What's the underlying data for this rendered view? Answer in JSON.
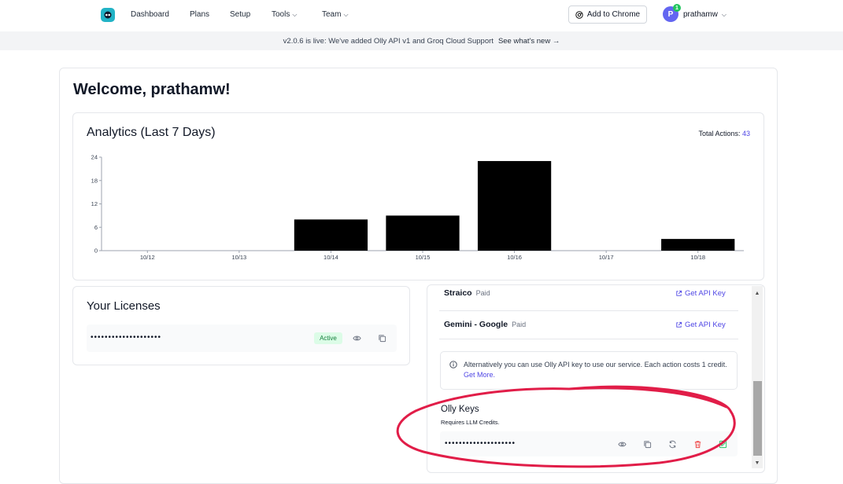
{
  "nav": {
    "items": [
      {
        "label": "Dashboard"
      },
      {
        "label": "Plans"
      },
      {
        "label": "Setup"
      },
      {
        "label": "Tools"
      },
      {
        "label": "Team"
      }
    ],
    "add_to_chrome": "Add to Chrome",
    "avatar_initial": "P",
    "notification_count": "1",
    "username": "prathamw"
  },
  "banner": {
    "text": "v2.0.6 is live: We've added Olly API v1 and Groq Cloud Support",
    "link": "See what's new →"
  },
  "welcome": "Welcome, prathamw!",
  "analytics": {
    "title": "Analytics (Last 7 Days)",
    "total_label": "Total Actions:",
    "total_value": "43"
  },
  "chart_data": {
    "type": "bar",
    "categories": [
      "10/12",
      "10/13",
      "10/14",
      "10/15",
      "10/16",
      "10/17",
      "10/18"
    ],
    "values": [
      0,
      0,
      8,
      9,
      23,
      0,
      3
    ],
    "ylim": [
      0,
      24
    ],
    "yticks": [
      0,
      6,
      12,
      18,
      24
    ],
    "bar_color": "#000000",
    "grid": false
  },
  "licenses": {
    "title": "Your Licenses",
    "key_masked": "••••••••••••••••••••",
    "status": "Active"
  },
  "providers": [
    {
      "name": "Straico",
      "tag": "Paid",
      "action": "Get API Key"
    },
    {
      "name": "Gemini - Google",
      "tag": "Paid",
      "action": "Get API Key"
    }
  ],
  "info": {
    "text": "Alternatively you can use Olly API key to use our service. Each action costs 1 credit.",
    "link": "Get More."
  },
  "olly": {
    "title": "Olly Keys",
    "subtitle": "Requires LLM Credits.",
    "key_masked": "••••••••••••••••••••"
  },
  "colors": {
    "accent": "#4f46e5",
    "active_badge_bg": "#dcfce7",
    "active_badge_text": "#15803d",
    "annotation": "#e11d48",
    "delete": "#ef4444",
    "success": "#22c55e"
  },
  "icons": [
    "logo-icon",
    "chrome-icon",
    "chevron-down-icon",
    "arrow-right-icon",
    "eye-icon",
    "copy-icon",
    "refresh-icon",
    "trash-icon",
    "edit-icon",
    "external-link-icon",
    "info-icon"
  ]
}
